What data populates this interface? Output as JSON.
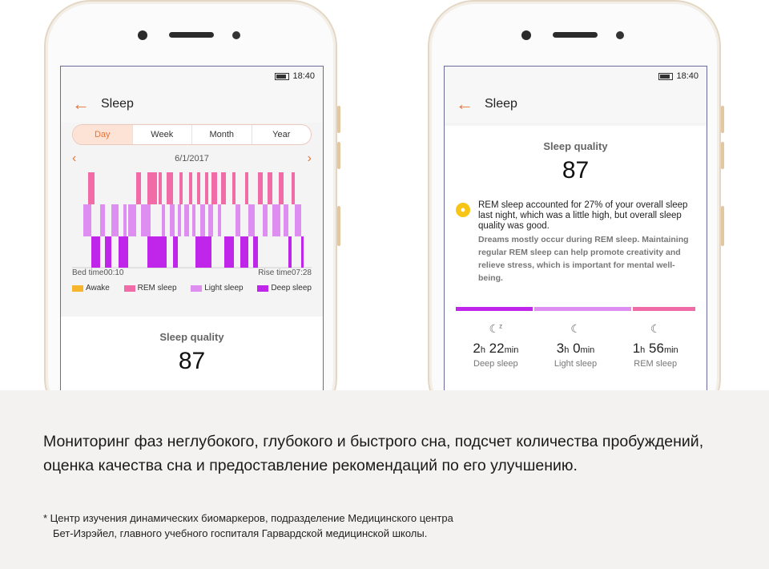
{
  "status": {
    "time": "18:40"
  },
  "left_screen": {
    "title": "Sleep",
    "tabs": [
      "Day",
      "Week",
      "Month",
      "Year"
    ],
    "active_tab": "Day",
    "date": "6/1/2017",
    "bed_time": "Bed time00:10",
    "rise_time": "Rise time07:28",
    "legend": [
      {
        "label": "Awake",
        "color": "#f6b52a"
      },
      {
        "label": "REM sleep",
        "color": "#f16ba6"
      },
      {
        "label": "Light sleep",
        "color": "#dd8ef0"
      },
      {
        "label": "Deep sleep",
        "color": "#c026ea"
      }
    ],
    "quality_label": "Sleep quality",
    "quality_score": "87"
  },
  "right_screen": {
    "title": "Sleep",
    "quality_label": "Sleep quality",
    "quality_score": "87",
    "tip_main": "REM sleep accounted for 27% of your overall sleep last night, which was a little high, but overall sleep quality was good.",
    "tip_sub": "Dreams mostly occur during REM sleep. Maintaining regular REM sleep can help promote creativity and relieve stress, which is important for mental well-being.",
    "stages": [
      {
        "h": "2",
        "m": "22",
        "name": "Deep sleep",
        "icon": "moon-zz-icon"
      },
      {
        "h": "3",
        "m": "0",
        "name": "Light sleep",
        "icon": "moon-icon"
      },
      {
        "h": "1",
        "m": "56",
        "name": "REM sleep",
        "icon": "moon-icon"
      }
    ],
    "units": {
      "h": "h",
      "m": "min"
    }
  },
  "bottom": {
    "text": "Мониторинг фаз неглубокого, глубокого и быстрого сна, подсчет количества пробуждений, оценка качества сна и предоставление рекомендаций по его улучшению.",
    "footnote_line1": "* Центр изучения динамических биомаркеров, подразделение Медицинского центра",
    "footnote_line2": "Бет-Изрэйел, главного учебного госпиталя Гарвардской медицинской школы."
  }
}
